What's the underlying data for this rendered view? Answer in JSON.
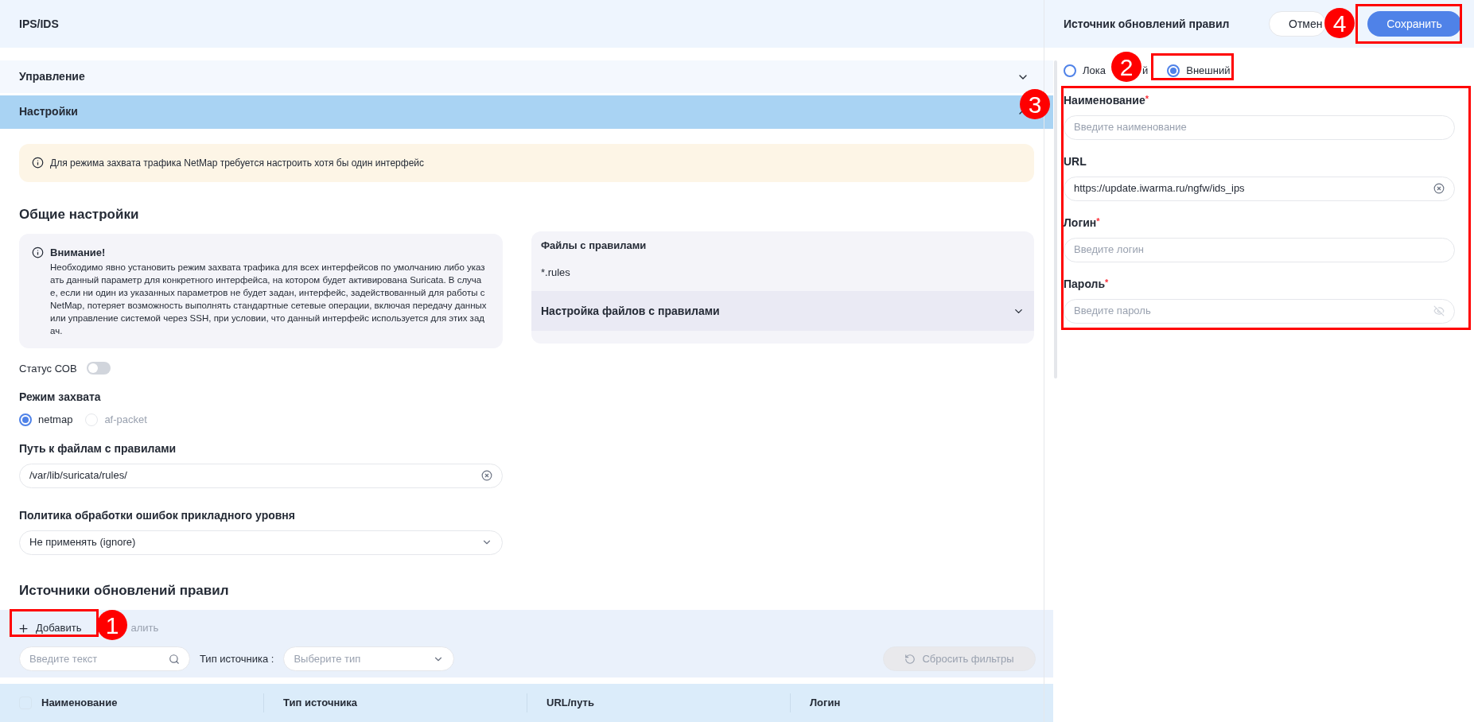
{
  "page_title": "IPS/IDS",
  "sections": [
    {
      "title": "Управление",
      "expanded": false
    },
    {
      "title": "Настройки",
      "expanded": true
    }
  ],
  "notice": "Для режима захвата трафика NetMap требуется настроить хотя бы один интерфейс",
  "general": {
    "heading": "Общие настройки",
    "attention": {
      "title": "Внимание!",
      "text": "Необходимо явно установить режим захвата трафика для всех интерфейсов по умолчанию либо указать данный параметр для конкретного интерфейса, на котором будет активирована Suricata. В случае, если ни один из указанных параметров не будет задан, интерфейс, задействованный для работы с NetMap, потеряет возможность выполнять стандартные сетевые операции, включая передачу данных или управление системой через SSH, при условии, что данный интерфейс используется для этих задач."
    },
    "status": {
      "label": "Статус СОВ",
      "on": false
    },
    "capture": {
      "label": "Режим захвата",
      "options": [
        {
          "label": "netmap",
          "selected": true,
          "disabled": false
        },
        {
          "label": "af-packet",
          "selected": false,
          "disabled": true
        }
      ]
    },
    "rules_path": {
      "label": "Путь к файлам с правилами",
      "value": "/var/lib/suricata/rules/"
    },
    "policy": {
      "label": "Политика обработки ошибок прикладного уровня",
      "value": "Не применять (ignore)"
    }
  },
  "rule_files": {
    "title": "Файлы с правилами",
    "value": "*.rules",
    "settings": {
      "title": "Настройка файлов с правилами",
      "expanded": false
    }
  },
  "sources": {
    "heading": "Источники обновлений правил",
    "toolbar": [
      {
        "kind": "add",
        "label": "Добавить",
        "disabled": false
      },
      {
        "kind": "delete",
        "label": "алить",
        "disabled": true
      }
    ],
    "search": {
      "placeholder": "Введите текст"
    },
    "type_filter": {
      "label": "Тип источника :",
      "placeholder": "Выберите тип"
    },
    "reset": {
      "label": "Сбросить фильтры",
      "disabled": true
    },
    "select_all": {
      "checked": false
    },
    "columns": [
      "Наименование",
      "Тип источника",
      "URL/путь",
      "Логин"
    ]
  },
  "drawer": {
    "title": "Источник обновлений правил",
    "required_mark": "*",
    "buttons": [
      {
        "kind": "secondary",
        "label": "Отмен"
      },
      {
        "kind": "primary",
        "label": "Сохранить"
      }
    ],
    "source_types": [
      {
        "parts": [
          "Лока",
          "й"
        ],
        "selected": false
      },
      {
        "parts": [
          "Внешний"
        ],
        "selected": true
      }
    ],
    "fields": [
      {
        "kind": "text",
        "label": "Наименование",
        "required": true,
        "placeholder": "Введите наименование"
      },
      {
        "kind": "clearable",
        "label": "URL",
        "required": false,
        "value": "https://update.iwarma.ru/ngfw/ids_ips"
      },
      {
        "kind": "text",
        "label": "Логин",
        "required": true,
        "placeholder": "Введите логин"
      },
      {
        "kind": "password",
        "label": "Пароль",
        "required": true,
        "placeholder": "Введите пароль"
      }
    ]
  },
  "annotations": [
    {
      "number": "1"
    },
    {
      "number": "2"
    },
    {
      "number": "3"
    },
    {
      "number": "4"
    }
  ]
}
